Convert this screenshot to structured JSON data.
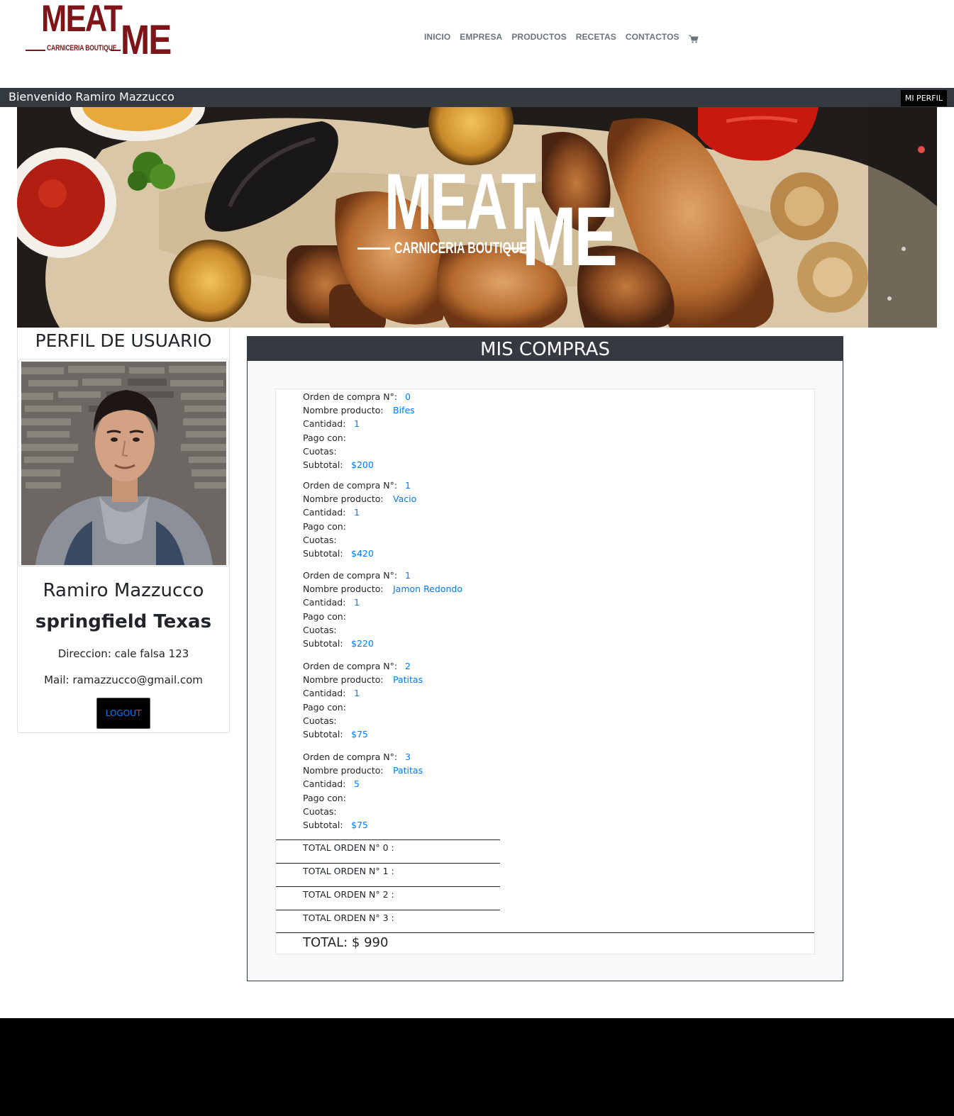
{
  "brand": {
    "word1": "MEAT",
    "word2": "ME",
    "tagline": "CARNICERIA BOUTIQUE",
    "color": "#7d1518"
  },
  "nav": {
    "items": [
      "INICIO",
      "EMPRESA",
      "PRODUCTOS",
      "RECETAS",
      "CONTACTOS"
    ],
    "cart_icon": "shopping-cart-icon"
  },
  "welcome": {
    "text": "Bienvenido Ramiro Mazzucco",
    "profile_button": "MI PERFIL"
  },
  "profile": {
    "title": "PERFIL DE USUARIO",
    "name": "Ramiro Mazzucco",
    "city": "springfield Texas",
    "address": "Direccion: cale falsa 123",
    "mail": "Mail: ramazzucco@gmail.com",
    "logout": "LOGOUT"
  },
  "purchases": {
    "title": "MIS COMPRAS",
    "labels": {
      "order": "Orden de compra N°:",
      "product": "Nombre producto:",
      "quantity": "Cantidad:",
      "payment": "Pago con:",
      "installments": "Cuotas:",
      "subtotal": "Subtotal:"
    },
    "orders": [
      {
        "order": "0",
        "product": "Bifes",
        "quantity": "1",
        "payment": "",
        "installments": "",
        "subtotal": "$200"
      },
      {
        "order": "1",
        "product": "Vacio",
        "quantity": "1",
        "payment": "",
        "installments": "",
        "subtotal": "$420"
      },
      {
        "order": "1",
        "product": "Jamon Redondo",
        "quantity": "1",
        "payment": "",
        "installments": "",
        "subtotal": "$220"
      },
      {
        "order": "2",
        "product": "Patitas",
        "quantity": "1",
        "payment": "",
        "installments": "",
        "subtotal": "$75"
      },
      {
        "order": "3",
        "product": "Patitas",
        "quantity": "5",
        "payment": "",
        "installments": "",
        "subtotal": "$75"
      }
    ],
    "order_totals": [
      "TOTAL ORDEN N° 0 :",
      "TOTAL ORDEN N° 1 :",
      "TOTAL ORDEN N° 2 :",
      "TOTAL ORDEN N° 3 :"
    ],
    "grand_total": "TOTAL: $ 990"
  },
  "colors": {
    "dark_bar": "#343a40",
    "link_blue": "#007bff",
    "footer": "#000000"
  }
}
